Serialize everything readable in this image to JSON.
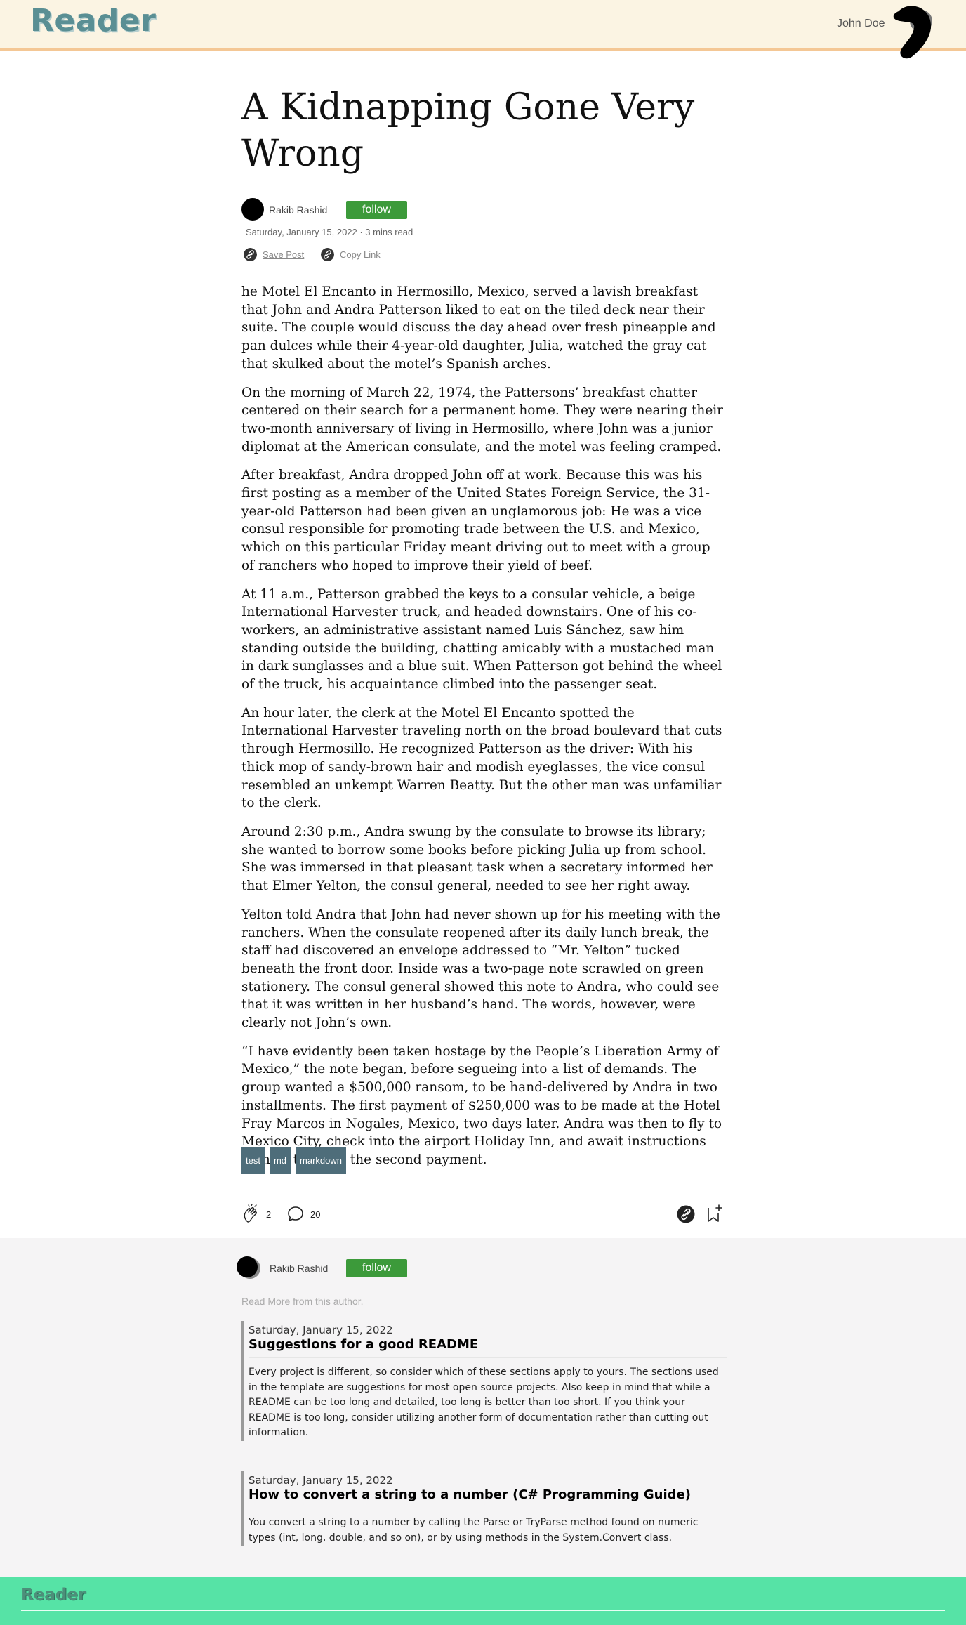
{
  "app": {
    "logo": "Reader"
  },
  "header": {
    "user_name": "John Doe"
  },
  "article": {
    "title": "A Kidnapping Gone Very Wrong",
    "author": "Rakib Rashid",
    "follow_label": "follow",
    "meta": "Saturday, January 15, 2022 · 3 mins read",
    "save_label": "Save Post",
    "copy_label": "Copy Link",
    "paragraphs": [
      "he Motel El Encanto in Hermosillo, Mexico, served a lavish breakfast that John and Andra Patterson liked to eat on the tiled deck near their suite. The couple would discuss the day ahead over fresh pineapple and pan dulces while their 4-year-old daughter, Julia, watched the gray cat that skulked about the motel’s Spanish arches.",
      "On the morning of March 22, 1974, the Pattersons’ breakfast chatter centered on their search for a permanent home. They were nearing their two-month anniversary of living in Hermosillo, where John was a junior diplomat at the American consulate, and the motel was feeling cramped.",
      "After breakfast, Andra dropped John off at work. Because this was his first posting as a member of the United States Foreign Service, the 31-year-old Patterson had been given an unglamorous job: He was a vice consul responsible for promoting trade between the U.S. and Mexico, which on this particular Friday meant driving out to meet with a group of ranchers who hoped to improve their yield of beef.",
      "At 11 a.m., Patterson grabbed the keys to a consular vehicle, a beige International Harvester truck, and headed downstairs. One of his co-workers, an administrative assistant named Luis Sánchez, saw him standing outside the building, chatting amicably with a mustached man in dark sunglasses and a blue suit. When Patterson got behind the wheel of the truck, his acquaintance climbed into the passenger seat.",
      "An hour later, the clerk at the Motel El Encanto spotted the International Harvester traveling north on the broad boulevard that cuts through Hermosillo. He recognized Patterson as the driver: With his thick mop of sandy-brown hair and modish eyeglasses, the vice consul resembled an unkempt Warren Beatty. But the other man was unfamiliar to the clerk.",
      "Around 2:30 p.m., Andra swung by the consulate to browse its library; she wanted to borrow some books before picking Julia up from school. She was immersed in that pleasant task when a secretary informed her that Elmer Yelton, the consul general, needed to see her right away.",
      "Yelton told Andra that John had never shown up for his meeting with the ranchers. When the consulate reopened after its daily lunch break, the staff had discovered an envelope addressed to “Mr. Yelton” tucked beneath the front door. Inside was a two-page note scrawled on green stationery. The consul general showed this note to Andra, who could see that it was written in her husband’s hand. The words, however, were clearly not John’s own.",
      "“I have evidently been taken hostage by the People’s Liberation Army of Mexico,” the note began, before segueing into a list of demands. The group wanted a $500,000 ransom, to be hand-delivered by Andra in two installments. The first payment of $250,000 was to be made at the Hotel Fray Marcos in Nogales, Mexico, two days later. Andra was then to fly to Mexico City, check into the airport Holiday Inn, and await instructions on how to make the second payment."
    ],
    "tags": [
      "test",
      "md",
      "markdown"
    ],
    "claps": "2",
    "comments": "20"
  },
  "more": {
    "author": "Rakib Rashid",
    "follow_label": "follow",
    "read_more": "Read More from this author.",
    "posts": [
      {
        "date": "Saturday, January 15, 2022",
        "title": "Suggestions for a good README",
        "excerpt": "Every project is different, so consider which of these sections apply to yours. The sections used in the template are suggestions for most open source projects. Also keep in mind that while a README can be too long and detailed, too long is better than too short. If you think your README is too long, consider utilizing another form of documentation rather than cutting out information."
      },
      {
        "date": "Saturday, January 15, 2022",
        "title": "How to convert a string to a number (C# Programming Guide)",
        "excerpt": "You convert a string to a number by calling the Parse or TryParse method found on numeric types (int, long, double, and so on), or by using methods in the System.Convert class."
      }
    ]
  },
  "footer": {
    "logo": "Reader"
  }
}
